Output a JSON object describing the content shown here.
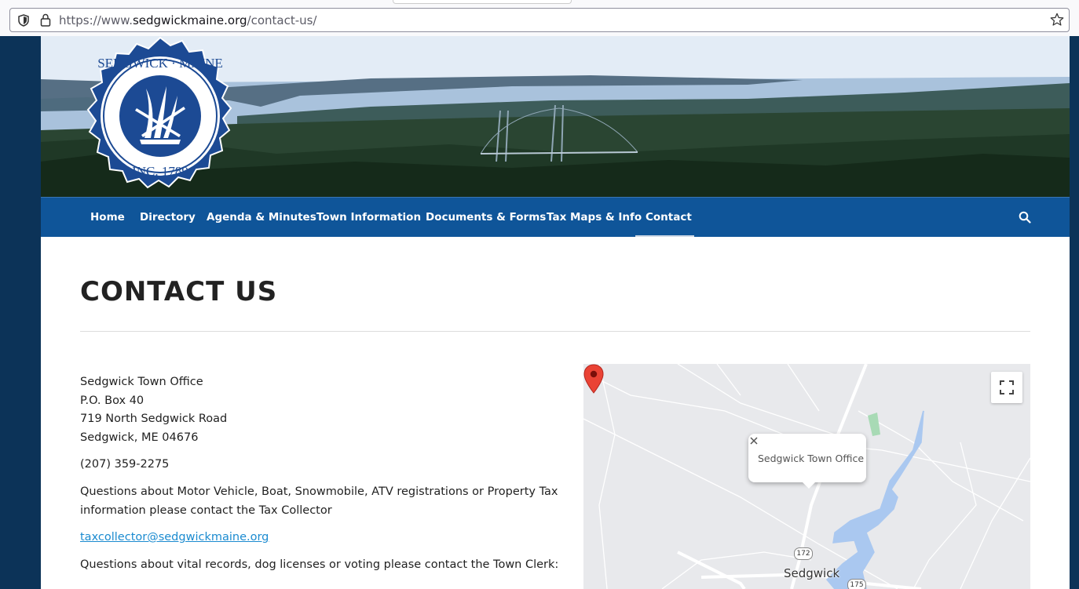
{
  "browser": {
    "url_prefix": "https://www.",
    "url_host": "sedgwickmaine.org",
    "url_path": "/contact-us/"
  },
  "header": {
    "logo_text_top": "SEDGWICK · MAINE",
    "logo_text_bottom": "INC. 1789"
  },
  "nav": {
    "items": [
      {
        "label": "Home"
      },
      {
        "label": "Directory"
      },
      {
        "label": "Agenda & Minutes"
      },
      {
        "label": "Town Information"
      },
      {
        "label": "Documents & Forms"
      },
      {
        "label": "Tax Maps & Info"
      },
      {
        "label": "Contact"
      }
    ],
    "active": "Contact"
  },
  "page": {
    "title": "CONTACT US",
    "address_lines": [
      "Sedgwick Town Office",
      "P.O. Box 40",
      "719 North Sedgwick Road",
      "Sedgwick, ME 04676"
    ],
    "phone": "(207) 359-2275",
    "tax_question_line1": "Questions about Motor Vehicle, Boat, Snowmobile, ATV registrations or Property Tax",
    "tax_question_line2": "information please contact the Tax Collector",
    "tax_email": "taxcollector@sedgwickmaine.org",
    "clerk_question": "Questions about vital records, dog licenses or voting please contact the Town Clerk:"
  },
  "map": {
    "info_window_text": "Sedgwick Town Office",
    "town_label": "Sedgwick",
    "route_172": "172",
    "route_175": "175"
  },
  "colors": {
    "nav_bg": "#0f5599",
    "page_bg": "#0c3358",
    "link": "#1b8bd0",
    "logo_blue": "#1c4a94"
  }
}
